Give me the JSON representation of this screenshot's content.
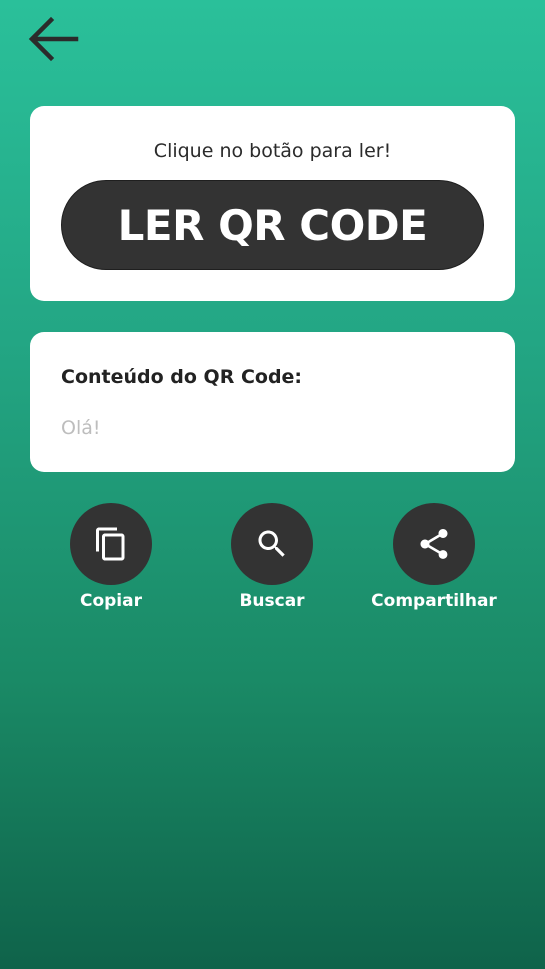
{
  "header": {
    "back_icon": "arrow-left-icon"
  },
  "read_card": {
    "hint": "Clique no botão para ler!",
    "button_label": "LER QR CODE"
  },
  "content_card": {
    "label": "Conteúdo do QR Code:",
    "value": "Olá!"
  },
  "actions": [
    {
      "label": "Copiar",
      "icon": "copy-icon"
    },
    {
      "label": "Buscar",
      "icon": "search-icon"
    },
    {
      "label": "Compartilhar",
      "icon": "share-icon"
    }
  ],
  "colors": {
    "background_top": "#2ac09a",
    "background_bottom": "#0f634a",
    "button_dark": "#333333",
    "card": "#ffffff",
    "placeholder_text": "#bdbdbd"
  }
}
